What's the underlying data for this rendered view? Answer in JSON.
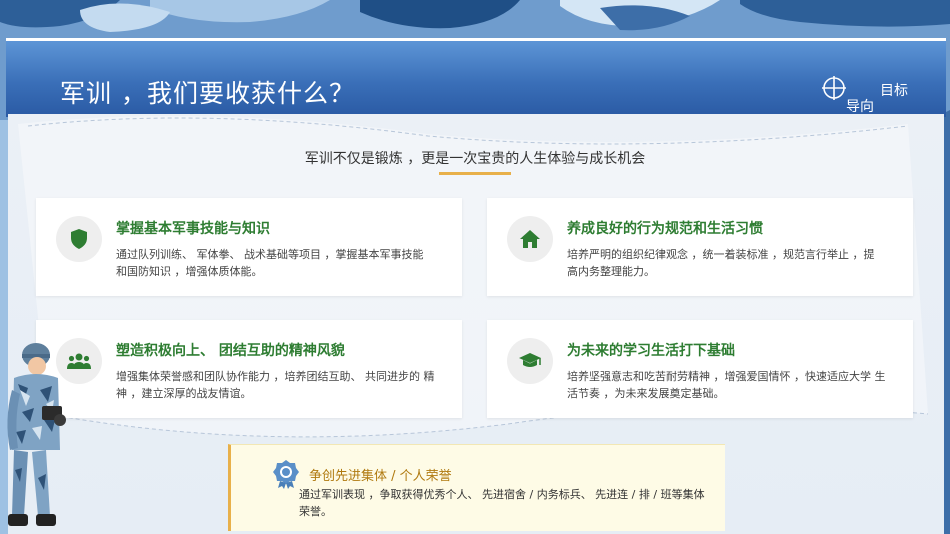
{
  "header": {
    "title": "军训 ，我们要收获什么？",
    "nav_label_1": "目标",
    "nav_label_2": "导向"
  },
  "intro": {
    "subtitle": "军训不仅是锻炼 ，更是一次宝贵的人生体验与成长机会"
  },
  "cards": [
    {
      "title": "掌握基本军事技能与知识",
      "desc": "通过队列训练、 军体拳、 战术基础等项目 ，掌握基本军事技能 和国防知识 ，增强体质体能。",
      "icon": "shield-icon"
    },
    {
      "title": "养成良好的行为规范和生活习惯",
      "desc": "培养严明的组织纪律观念 ，统一着装标准 ，规范言行举止 ，提 高内务整理能力。",
      "icon": "home-icon"
    },
    {
      "title": "塑造积极向上、 团结互助的精神风貌",
      "desc": "增强集体荣誉感和团队协作能力 ，培养团结互助、 共同进步的 精神 ，建立深厚的战友情谊。",
      "icon": "team-icon"
    },
    {
      "title": "为未来的学习生活打下基础",
      "desc": "培养坚强意志和吃苦耐劳精神 ，增强爱国情怀 ，快速适应大学 生活节奏 ，为未来发展奠定基础。",
      "icon": "graduation-cap-icon"
    }
  ],
  "award": {
    "title": "争创先进集体 / 个人荣誉",
    "desc": "通过军训表现 ，争取获得优秀个人、 先进宿舍 / 内务标兵、 先进连 / 排 / 班等集体 荣誉。",
    "icon": "medal-icon"
  },
  "colors": {
    "header_blue": "#3a6fb8",
    "card_title_green": "#2e7d32",
    "accent_gold": "#e8b04a"
  }
}
